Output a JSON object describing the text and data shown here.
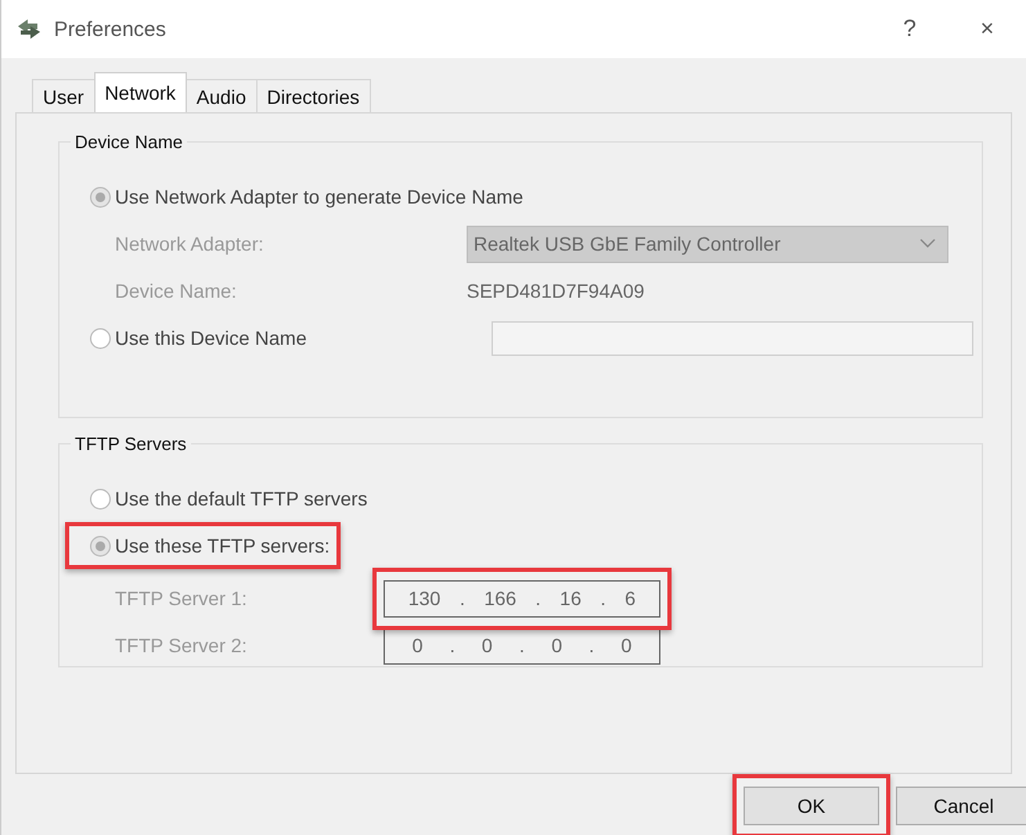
{
  "window": {
    "title": "Preferences",
    "help": "?",
    "close": "×"
  },
  "tabs": [
    {
      "label": "User",
      "selected": false
    },
    {
      "label": "Network",
      "selected": true
    },
    {
      "label": "Audio",
      "selected": false
    },
    {
      "label": "Directories",
      "selected": false
    }
  ],
  "device_name": {
    "title": "Device Name",
    "rows": [
      {
        "kind": "radio",
        "label": "Use Network Adapter to generate Device Name",
        "selected": true,
        "highlighted": false
      },
      {
        "kind": "dropdown",
        "label": "Network Adapter:",
        "value": "Realtek USB GbE Family Controller"
      },
      {
        "kind": "text",
        "label": "Device Name:",
        "value": "SEPD481D7F94A09"
      },
      {
        "kind": "radio_field",
        "label": "Use this Device Name",
        "selected": false,
        "highlighted": false
      }
    ]
  },
  "tftp_servers": {
    "title": "TFTP Servers",
    "rows": [
      {
        "kind": "radio",
        "label": "Use the default TFTP servers",
        "selected": false,
        "highlighted": false
      },
      {
        "kind": "radio",
        "label": "Use these TFTP servers:",
        "selected": true,
        "highlighted": true
      },
      {
        "kind": "ip",
        "label": "TFTP Server 1:",
        "octets": [
          "130",
          "166",
          "16",
          "6"
        ],
        "separator": ".",
        "highlighted": true
      },
      {
        "kind": "ip",
        "label": "TFTP Server 2:",
        "octets": [
          "0",
          "0",
          "0",
          "0"
        ],
        "separator": ".",
        "highlighted": false
      }
    ]
  },
  "buttons": [
    {
      "label": "OK",
      "highlighted": true
    },
    {
      "label": "Cancel",
      "highlighted": false
    }
  ]
}
